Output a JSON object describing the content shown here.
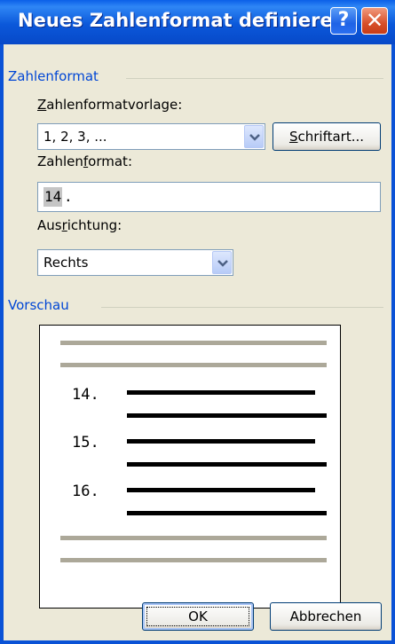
{
  "window": {
    "title": "Neues Zahlenformat definieren",
    "help_glyph": "?",
    "close_glyph": "✕"
  },
  "number_format_group": {
    "label": "Zahlenformat",
    "template_label": {
      "pre": "",
      "acc": "Z",
      "post": "ahlenformatvorlage:"
    },
    "template_value": "1, 2, 3, ...",
    "font_button": {
      "pre": "",
      "acc": "S",
      "post": "chriftart..."
    },
    "format_label": {
      "pre": "Zahlen",
      "acc": "f",
      "post": "ormat:"
    },
    "format_value_selected": "14",
    "format_value_rest": ".",
    "alignment_label": {
      "pre": "Aus",
      "acc": "r",
      "post": "ichtung:"
    },
    "alignment_value": "Rechts"
  },
  "preview_group": {
    "label": "Vorschau",
    "numbers": [
      "14.",
      "15.",
      "16."
    ]
  },
  "buttons": {
    "ok": "OK",
    "cancel": "Abbrechen"
  },
  "icons": {
    "dropdown": "chevron-down-icon",
    "help": "help-icon",
    "close": "close-icon"
  },
  "colors": {
    "title_bar": "#0a52d6",
    "dialog_background": "#ece9d8",
    "group_label": "#0046d5",
    "close_button": "#d8502a"
  }
}
